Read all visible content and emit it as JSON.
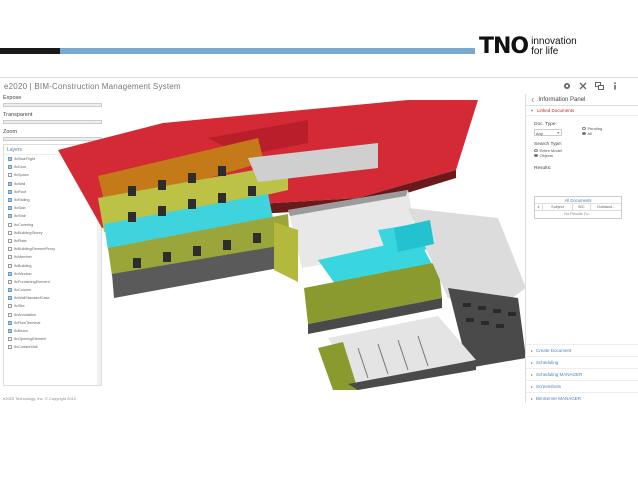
{
  "banner": {
    "logo_mark": "TNO",
    "tagline_1": "innovation",
    "tagline_2": "for life"
  },
  "app": {
    "title": "e2020  |  BIM-Construction Management System",
    "toolbar_icons": [
      "settings-icon",
      "tools-icon",
      "screens-icon",
      "info-icon"
    ],
    "footer": "e2020 Technology, Inc. © Copyright 2012"
  },
  "left_panel": {
    "expose_label": "Expose",
    "transparent_label": "Transparent",
    "zoom_label": "Zoom",
    "layers_title": "Layers",
    "layers": [
      {
        "label": "IfcStairFlight",
        "checked": true
      },
      {
        "label": "IfcDoor",
        "checked": true
      },
      {
        "label": "IfcSpace",
        "checked": false
      },
      {
        "label": "IfcWall",
        "checked": true
      },
      {
        "label": "IfcRoof",
        "checked": true
      },
      {
        "label": "IfcRailing",
        "checked": true
      },
      {
        "label": "IfcSlab",
        "checked": true
      },
      {
        "label": "IfcStair",
        "checked": true
      },
      {
        "label": "IfcCovering",
        "checked": false
      },
      {
        "label": "IfcBuildingStorey",
        "checked": false
      },
      {
        "label": "IfcPlate",
        "checked": false
      },
      {
        "label": "IfcBuildingElementProxy",
        "checked": false
      },
      {
        "label": "IfcMember",
        "checked": false
      },
      {
        "label": "IfcBuilding",
        "checked": false
      },
      {
        "label": "IfcWindow",
        "checked": true
      },
      {
        "label": "IfcFurnishingElement",
        "checked": false
      },
      {
        "label": "IfcColumn",
        "checked": true
      },
      {
        "label": "IfcWallStandardCase",
        "checked": true
      },
      {
        "label": "IfcSite",
        "checked": false
      },
      {
        "label": "IfcAnnotation",
        "checked": false
      },
      {
        "label": "IfcFlowTerminal",
        "checked": true
      },
      {
        "label": "IfcBeam",
        "checked": true
      },
      {
        "label": "IfcOpeningElement",
        "checked": false
      },
      {
        "label": "IfcCurtainWall",
        "checked": false
      }
    ]
  },
  "info_panel": {
    "title": "Information Panel",
    "section_linked": "Linked Documents",
    "doc_type_label": "Doc. Type:",
    "doc_type_value": "Any",
    "pending_label": "Pending",
    "all_label": "All",
    "search_type_label": "Search Type:",
    "entire_model_label": "Entire Model",
    "objects_label": "Objects",
    "results_label": "Results:",
    "results_table": {
      "title": "All Documents",
      "columns": [
        "#",
        "Subject",
        "B/C",
        "Outstand..."
      ],
      "empty_text": "No Results Fo..."
    },
    "links": [
      "Create Document",
      "Scheduling",
      "Scheduling MANAGER",
      "Screenshots",
      "BimServer MANAGER"
    ]
  },
  "colors": {
    "roof": "#d42a35",
    "wall_olive": "#9aa53a",
    "glass_cyan": "#39d6e0",
    "slab_dark": "#4a4a4a",
    "accent_blue": "#4b84b8"
  }
}
